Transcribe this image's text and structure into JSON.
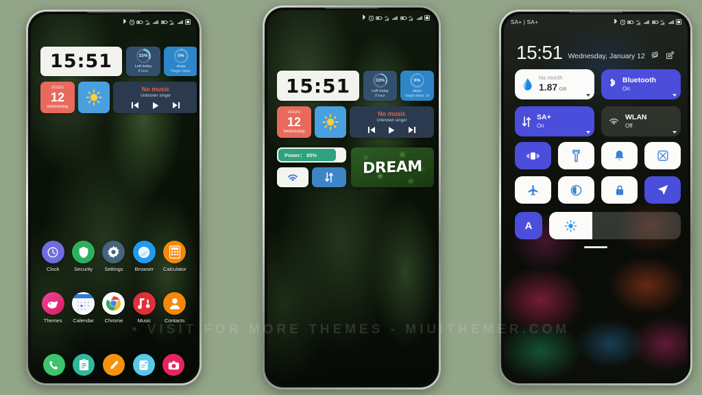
{
  "background_color": "#93a588",
  "watermark": "• VISIT FOR MORE THEMES - MIUITHEMER.COM",
  "status_bar": {
    "icons": [
      "bluetooth-icon",
      "alarm-icon",
      "battery-icon",
      "signal-4g-icon",
      "signal-bars-icon",
      "battery-icon",
      "signal-4g-icon",
      "signal-bars-icon",
      "sim-icon"
    ],
    "carrier": "SA+ | SA+"
  },
  "phone1": {
    "clock": {
      "time": "15:51"
    },
    "battery_widget": {
      "percent": "33%",
      "label": "Left today",
      "sub": "8 hour",
      "ring_value": 33
    },
    "steps_widget": {
      "percent": "0%",
      "label": "steps",
      "sub": "Target steps:",
      "ring_value": 0
    },
    "date_widget": {
      "year_month": "2022/1",
      "day": "12",
      "weekday": "Wednesday"
    },
    "weather_widget": {
      "icon": "sun-icon"
    },
    "music_widget": {
      "title": "No music",
      "subtitle": "Unknown singer",
      "prev": "prev-track-icon",
      "play": "play-icon",
      "next": "next-track-icon"
    },
    "apps_row1": [
      {
        "label": "Clock",
        "icon": "clock-icon",
        "color": "#6f6ce0"
      },
      {
        "label": "Security",
        "icon": "shield-icon",
        "color": "#2db05e"
      },
      {
        "label": "Settings",
        "icon": "gear-icon",
        "color": "#4a6d8c"
      },
      {
        "label": "Browser",
        "icon": "browser-icon",
        "color": "#2196f3"
      },
      {
        "label": "Calculator",
        "icon": "calculator-icon",
        "color": "#f5880a"
      }
    ],
    "apps_row2": [
      {
        "label": "Themes",
        "icon": "themes-icon",
        "color": "#e5337e"
      },
      {
        "label": "Calendar",
        "icon": "calendar-icon",
        "color": "#f4f6fa"
      },
      {
        "label": "Chrome",
        "icon": "chrome-icon",
        "color": "#ffffff"
      },
      {
        "label": "Music",
        "icon": "music-icon",
        "color": "#e02f3c"
      },
      {
        "label": "Contacts",
        "icon": "contacts-icon",
        "color": "#f5880a"
      }
    ],
    "dock": [
      {
        "label": "Phone",
        "icon": "phone-icon",
        "color": "#3ec46d"
      },
      {
        "label": "Notes",
        "icon": "notes-icon",
        "color": "#2fb89a"
      },
      {
        "label": "Tools",
        "icon": "pencil-icon",
        "color": "#f5930d"
      },
      {
        "label": "Messages",
        "icon": "messages-icon",
        "color": "#5ac8e8"
      },
      {
        "label": "Camera",
        "icon": "camera-icon",
        "color": "#e8245e"
      }
    ]
  },
  "phone2": {
    "clock": {
      "time": "15:51"
    },
    "battery_widget": {
      "percent": "33%",
      "label": "Left today",
      "sub": "8 hour",
      "ring_value": 33
    },
    "steps_widget": {
      "percent": "0%",
      "label": "steps",
      "sub": "Target steps: 10",
      "ring_value": 0
    },
    "date_widget": {
      "year_month": "2022/1",
      "day": "12",
      "weekday": "Wednesday"
    },
    "weather_widget": {
      "icon": "sun-icon"
    },
    "music_widget": {
      "title": "No music",
      "subtitle": "Unknown singer"
    },
    "power_widget": {
      "text": "Power： 85%",
      "percent": 85
    },
    "wifi_tile": {
      "icon": "wifi-icon"
    },
    "data_tile": {
      "icon": "data-transfer-icon"
    },
    "photo_widget": {
      "word": "DREAM"
    }
  },
  "phone3": {
    "carrier": "SA+ | SA+",
    "time": "15:51",
    "date": "Wednesday, January 12",
    "head_icons": [
      "settings-gear-icon",
      "edit-icon"
    ],
    "big_tiles": [
      {
        "name": "data-usage-tile",
        "icon": "data-drop-icon",
        "top": "his month",
        "title": "1.87",
        "unit": "GB",
        "state": "white"
      },
      {
        "name": "bluetooth-tile",
        "icon": "bluetooth-icon",
        "title": "Bluetooth",
        "sub": "On",
        "state": "on"
      },
      {
        "name": "mobile-data-tile",
        "icon": "data-transfer-icon",
        "title": "SA+",
        "sub": "On",
        "state": "on"
      },
      {
        "name": "wlan-tile",
        "icon": "wifi-icon",
        "title": "WLAN",
        "sub": "Off",
        "state": "off"
      }
    ],
    "toggles": [
      {
        "name": "vibrate-toggle",
        "icon": "vibrate-icon",
        "state": "on"
      },
      {
        "name": "flashlight-toggle",
        "icon": "flashlight-icon",
        "state": "off"
      },
      {
        "name": "ringer-toggle",
        "icon": "bell-icon",
        "state": "off"
      },
      {
        "name": "screenshot-toggle",
        "icon": "screenshot-icon",
        "state": "off"
      },
      {
        "name": "airplane-toggle",
        "icon": "airplane-icon",
        "state": "off"
      },
      {
        "name": "darkmode-toggle",
        "icon": "dark-mode-icon",
        "state": "off"
      },
      {
        "name": "rotation-lock-toggle",
        "icon": "lock-icon",
        "state": "off"
      },
      {
        "name": "location-toggle",
        "icon": "location-arrow-icon",
        "state": "on"
      }
    ],
    "auto_brightness": {
      "label": "A"
    },
    "brightness": {
      "icon": "brightness-icon",
      "percent": 33
    }
  }
}
